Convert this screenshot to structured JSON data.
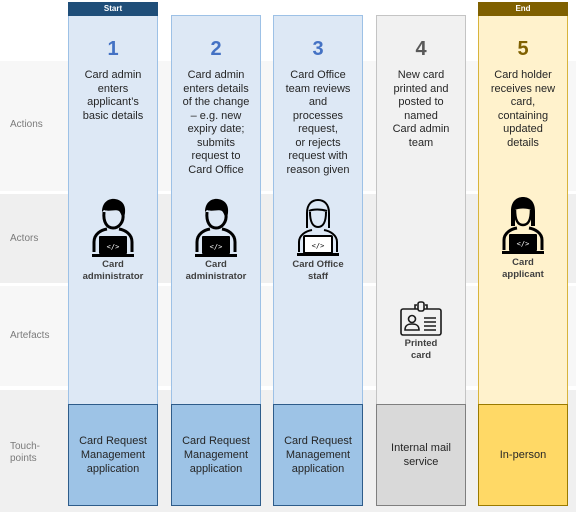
{
  "rows": {
    "actions": "Actions",
    "actors": "Actors",
    "artefacts": "Artefacts",
    "touchpoints_line1": "Touch-",
    "touchpoints_line2": "points"
  },
  "colors": {
    "start_header": "#1f4e79",
    "end_header": "#7f6000",
    "blue_step_number": "#4472c4",
    "blue_column": "#dde8f5",
    "grey_column": "#f1f1f1",
    "gold_column": "#fff2cc",
    "blue_touchpoint": "#9dc3e6",
    "grey_touchpoint": "#d9d9d9",
    "gold_touchpoint": "#ffd966"
  },
  "steps": [
    {
      "header": "Start",
      "number": "1",
      "action": [
        "Card admin",
        "enters",
        "applicant’s",
        "basic details"
      ],
      "actor_icon": "developer-person-icon",
      "actor": [
        "Card",
        "administrator"
      ],
      "artefact": null,
      "touchpoint": [
        "Card Request",
        "Management",
        "application"
      ]
    },
    {
      "header": null,
      "number": "2",
      "action": [
        "Card admin",
        "enters details",
        "of the change",
        "– e.g. new",
        "expiry date;",
        "submits",
        "request to",
        "Card Office"
      ],
      "actor_icon": "developer-person-icon",
      "actor": [
        "Card",
        "administrator"
      ],
      "artefact": null,
      "touchpoint": [
        "Card Request",
        "Management",
        "application"
      ]
    },
    {
      "header": null,
      "number": "3",
      "action": [
        "Card Office",
        "team reviews",
        "and",
        "processes",
        "request,",
        "or rejects",
        "request with",
        "reason given"
      ],
      "actor_icon": "developer-woman-outline-icon",
      "actor": [
        "Card Office",
        "staff"
      ],
      "artefact": null,
      "touchpoint": [
        "Card Request",
        "Management",
        "application"
      ]
    },
    {
      "header": null,
      "number": "4",
      "action": [
        "New card",
        "printed and",
        "posted to",
        "named",
        "Card admin",
        "team"
      ],
      "actor_icon": null,
      "actor": null,
      "artefact": [
        "Printed",
        "card"
      ],
      "artefact_icon": "id-badge-icon",
      "touchpoint": [
        "Internal mail",
        "service"
      ]
    },
    {
      "header": "End",
      "number": "5",
      "action": [
        "Card holder",
        "receives new",
        "card,",
        "containing",
        "updated",
        "details"
      ],
      "actor_icon": "developer-woman-icon",
      "actor": [
        "Card",
        "applicant"
      ],
      "artefact": null,
      "touchpoint": [
        "In-person"
      ]
    }
  ]
}
